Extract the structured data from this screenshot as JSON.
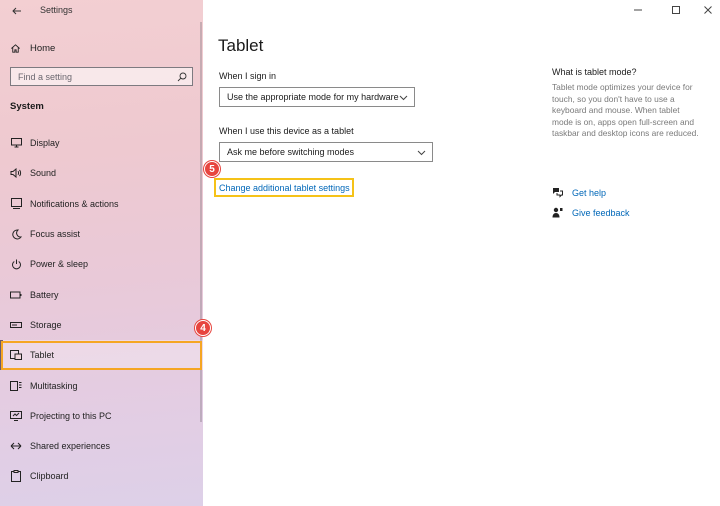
{
  "window": {
    "title": "Settings",
    "controls": [
      "minimize",
      "maximize",
      "close"
    ]
  },
  "sidebar": {
    "home_label": "Home",
    "search_placeholder": "Find a setting",
    "section_title": "System",
    "items": [
      {
        "label": "Display",
        "icon": "monitor-icon"
      },
      {
        "label": "Sound",
        "icon": "speaker-icon"
      },
      {
        "label": "Notifications & actions",
        "icon": "notification-icon"
      },
      {
        "label": "Focus assist",
        "icon": "moon-icon"
      },
      {
        "label": "Power & sleep",
        "icon": "power-icon"
      },
      {
        "label": "Battery",
        "icon": "battery-icon"
      },
      {
        "label": "Storage",
        "icon": "storage-icon"
      },
      {
        "label": "Tablet",
        "icon": "tablet-icon",
        "selected": true
      },
      {
        "label": "Multitasking",
        "icon": "multitasking-icon"
      },
      {
        "label": "Projecting to this PC",
        "icon": "projecting-icon"
      },
      {
        "label": "Shared experiences",
        "icon": "shared-experiences-icon"
      },
      {
        "label": "Clipboard",
        "icon": "clipboard-icon"
      }
    ]
  },
  "badges": {
    "tablet_step": "4",
    "link_step": "5"
  },
  "main": {
    "title": "Tablet",
    "signin_label": "When I sign in",
    "signin_value": "Use the appropriate mode for my hardware",
    "tablet_label": "When I use this device as a tablet",
    "tablet_value": "Ask me before switching modes",
    "additional_link": "Change additional tablet settings"
  },
  "help": {
    "title": "What is tablet mode?",
    "body": "Tablet mode optimizes your device for touch, so you don't have to use a keyboard and mouse. When tablet mode is on, apps open full-screen and taskbar and desktop icons are reduced.",
    "get_help": "Get help",
    "give_feedback": "Give feedback"
  },
  "colors": {
    "accent_link": "#0067b8",
    "highlight_orange": "#f5a623",
    "highlight_yellow": "#f5c218",
    "badge_red": "#e7453f"
  }
}
